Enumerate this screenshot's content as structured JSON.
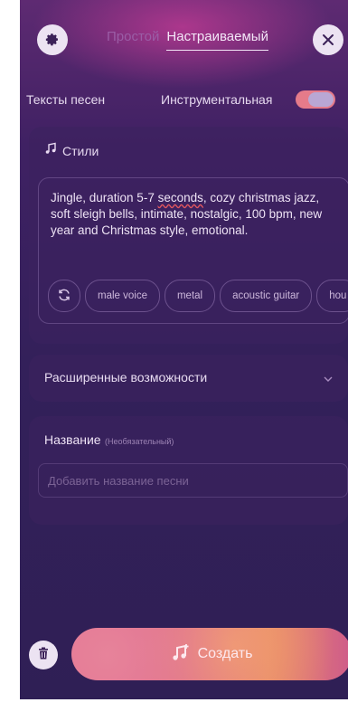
{
  "tabs": {
    "inactive": "Простой",
    "active": "Настраиваемый"
  },
  "toggles": {
    "lyrics_label": "Тексты песен",
    "instrumental_label": "Инструментальная",
    "instrumental_on": true
  },
  "styles": {
    "title": "Стили",
    "text_before": "Jingle, duration 5-7 ",
    "text_misspelled": "seconds",
    "text_after": ", cozy christmas jazz, soft sleigh bells, intimate, nostalgic, 100 bpm, new year and Christmas style, emotional.",
    "chips": [
      "male voice",
      "metal",
      "acoustic guitar",
      "hou"
    ]
  },
  "advanced": {
    "label": "Расширенные возможности"
  },
  "name": {
    "label": "Название",
    "optional": "(Необязательный)",
    "placeholder": "Добавить название песни"
  },
  "create_button": {
    "label": "Создать"
  },
  "colors": {
    "accent": "#e57b8a",
    "background": "#33205a"
  }
}
